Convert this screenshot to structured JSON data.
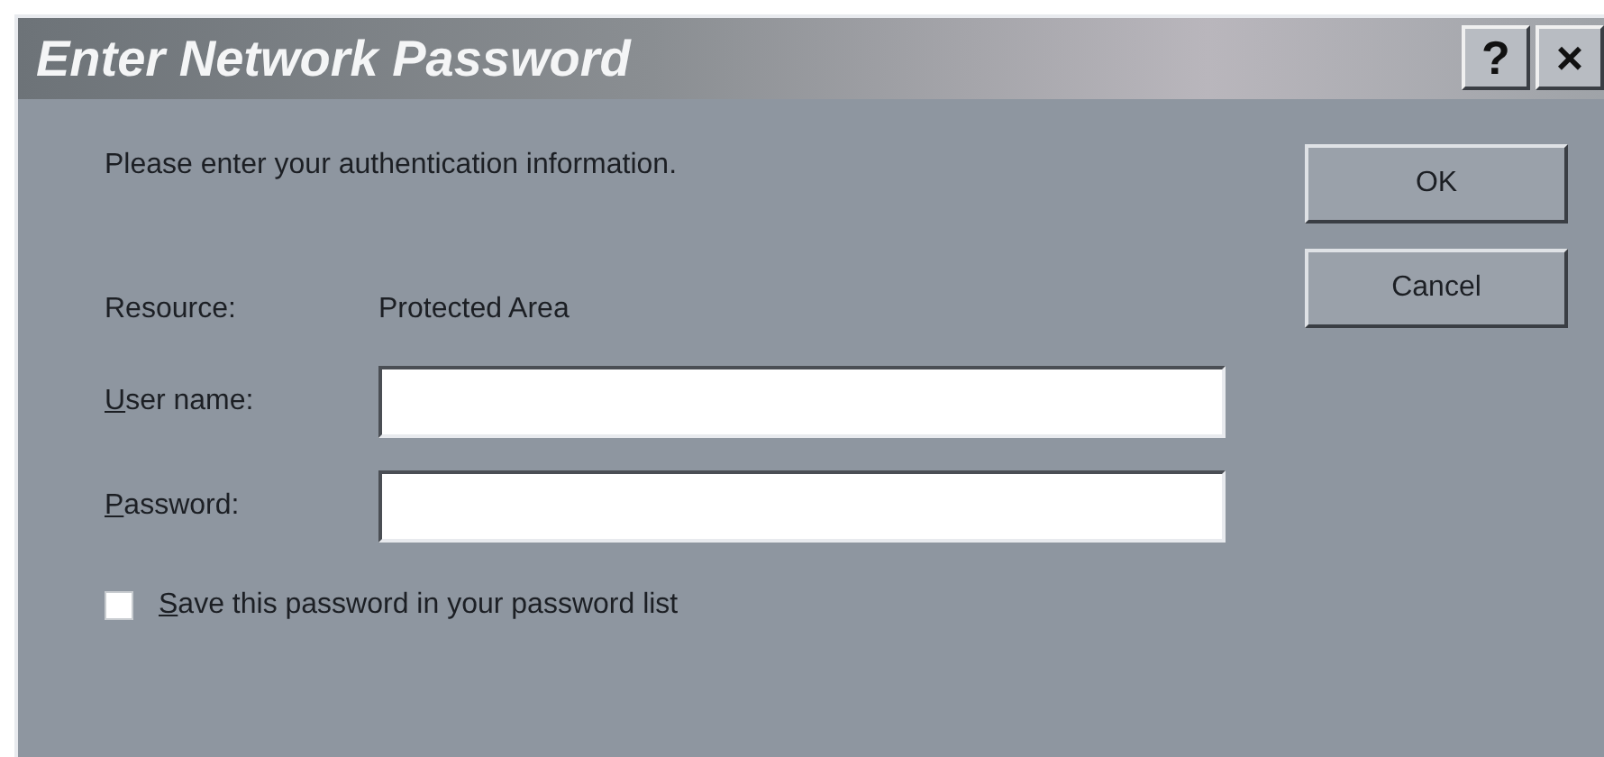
{
  "window": {
    "title": "Enter Network Password",
    "title_buttons": [
      "?",
      "×"
    ]
  },
  "prompt": "Please enter your authentication information.",
  "resource": {
    "label": "Resource:",
    "value": "Protected Area"
  },
  "fields": [
    {
      "label": "User name:"
    },
    {
      "label": "Password:"
    }
  ],
  "save_password": {
    "label": "Save this password in your password list",
    "checked": false
  },
  "buttons": [
    "OK",
    "Cancel"
  ]
}
